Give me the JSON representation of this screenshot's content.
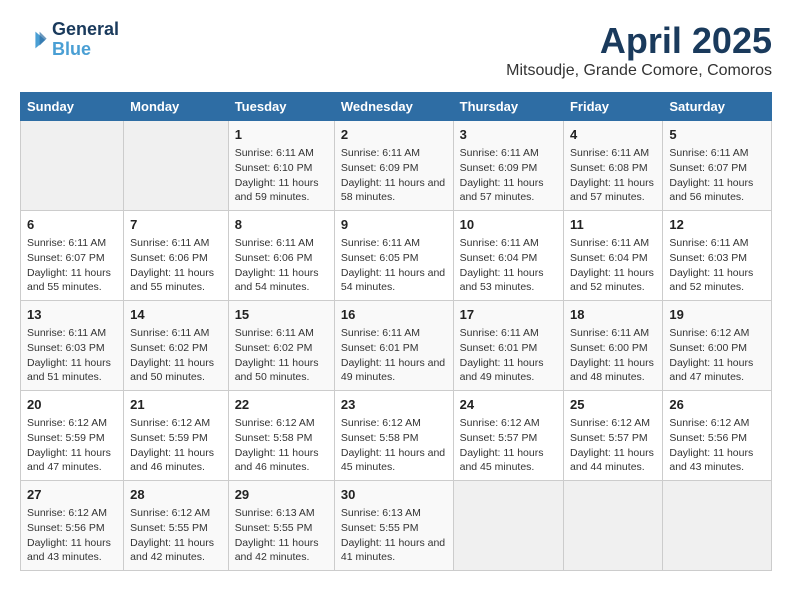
{
  "logo": {
    "line1": "General",
    "line2": "Blue"
  },
  "title": "April 2025",
  "subtitle": "Mitsoudje, Grande Comore, Comoros",
  "headers": [
    "Sunday",
    "Monday",
    "Tuesday",
    "Wednesday",
    "Thursday",
    "Friday",
    "Saturday"
  ],
  "weeks": [
    [
      {
        "num": "",
        "info": ""
      },
      {
        "num": "",
        "info": ""
      },
      {
        "num": "1",
        "info": "Sunrise: 6:11 AM\nSunset: 6:10 PM\nDaylight: 11 hours and 59 minutes."
      },
      {
        "num": "2",
        "info": "Sunrise: 6:11 AM\nSunset: 6:09 PM\nDaylight: 11 hours and 58 minutes."
      },
      {
        "num": "3",
        "info": "Sunrise: 6:11 AM\nSunset: 6:09 PM\nDaylight: 11 hours and 57 minutes."
      },
      {
        "num": "4",
        "info": "Sunrise: 6:11 AM\nSunset: 6:08 PM\nDaylight: 11 hours and 57 minutes."
      },
      {
        "num": "5",
        "info": "Sunrise: 6:11 AM\nSunset: 6:07 PM\nDaylight: 11 hours and 56 minutes."
      }
    ],
    [
      {
        "num": "6",
        "info": "Sunrise: 6:11 AM\nSunset: 6:07 PM\nDaylight: 11 hours and 55 minutes."
      },
      {
        "num": "7",
        "info": "Sunrise: 6:11 AM\nSunset: 6:06 PM\nDaylight: 11 hours and 55 minutes."
      },
      {
        "num": "8",
        "info": "Sunrise: 6:11 AM\nSunset: 6:06 PM\nDaylight: 11 hours and 54 minutes."
      },
      {
        "num": "9",
        "info": "Sunrise: 6:11 AM\nSunset: 6:05 PM\nDaylight: 11 hours and 54 minutes."
      },
      {
        "num": "10",
        "info": "Sunrise: 6:11 AM\nSunset: 6:04 PM\nDaylight: 11 hours and 53 minutes."
      },
      {
        "num": "11",
        "info": "Sunrise: 6:11 AM\nSunset: 6:04 PM\nDaylight: 11 hours and 52 minutes."
      },
      {
        "num": "12",
        "info": "Sunrise: 6:11 AM\nSunset: 6:03 PM\nDaylight: 11 hours and 52 minutes."
      }
    ],
    [
      {
        "num": "13",
        "info": "Sunrise: 6:11 AM\nSunset: 6:03 PM\nDaylight: 11 hours and 51 minutes."
      },
      {
        "num": "14",
        "info": "Sunrise: 6:11 AM\nSunset: 6:02 PM\nDaylight: 11 hours and 50 minutes."
      },
      {
        "num": "15",
        "info": "Sunrise: 6:11 AM\nSunset: 6:02 PM\nDaylight: 11 hours and 50 minutes."
      },
      {
        "num": "16",
        "info": "Sunrise: 6:11 AM\nSunset: 6:01 PM\nDaylight: 11 hours and 49 minutes."
      },
      {
        "num": "17",
        "info": "Sunrise: 6:11 AM\nSunset: 6:01 PM\nDaylight: 11 hours and 49 minutes."
      },
      {
        "num": "18",
        "info": "Sunrise: 6:11 AM\nSunset: 6:00 PM\nDaylight: 11 hours and 48 minutes."
      },
      {
        "num": "19",
        "info": "Sunrise: 6:12 AM\nSunset: 6:00 PM\nDaylight: 11 hours and 47 minutes."
      }
    ],
    [
      {
        "num": "20",
        "info": "Sunrise: 6:12 AM\nSunset: 5:59 PM\nDaylight: 11 hours and 47 minutes."
      },
      {
        "num": "21",
        "info": "Sunrise: 6:12 AM\nSunset: 5:59 PM\nDaylight: 11 hours and 46 minutes."
      },
      {
        "num": "22",
        "info": "Sunrise: 6:12 AM\nSunset: 5:58 PM\nDaylight: 11 hours and 46 minutes."
      },
      {
        "num": "23",
        "info": "Sunrise: 6:12 AM\nSunset: 5:58 PM\nDaylight: 11 hours and 45 minutes."
      },
      {
        "num": "24",
        "info": "Sunrise: 6:12 AM\nSunset: 5:57 PM\nDaylight: 11 hours and 45 minutes."
      },
      {
        "num": "25",
        "info": "Sunrise: 6:12 AM\nSunset: 5:57 PM\nDaylight: 11 hours and 44 minutes."
      },
      {
        "num": "26",
        "info": "Sunrise: 6:12 AM\nSunset: 5:56 PM\nDaylight: 11 hours and 43 minutes."
      }
    ],
    [
      {
        "num": "27",
        "info": "Sunrise: 6:12 AM\nSunset: 5:56 PM\nDaylight: 11 hours and 43 minutes."
      },
      {
        "num": "28",
        "info": "Sunrise: 6:12 AM\nSunset: 5:55 PM\nDaylight: 11 hours and 42 minutes."
      },
      {
        "num": "29",
        "info": "Sunrise: 6:13 AM\nSunset: 5:55 PM\nDaylight: 11 hours and 42 minutes."
      },
      {
        "num": "30",
        "info": "Sunrise: 6:13 AM\nSunset: 5:55 PM\nDaylight: 11 hours and 41 minutes."
      },
      {
        "num": "",
        "info": ""
      },
      {
        "num": "",
        "info": ""
      },
      {
        "num": "",
        "info": ""
      }
    ]
  ]
}
